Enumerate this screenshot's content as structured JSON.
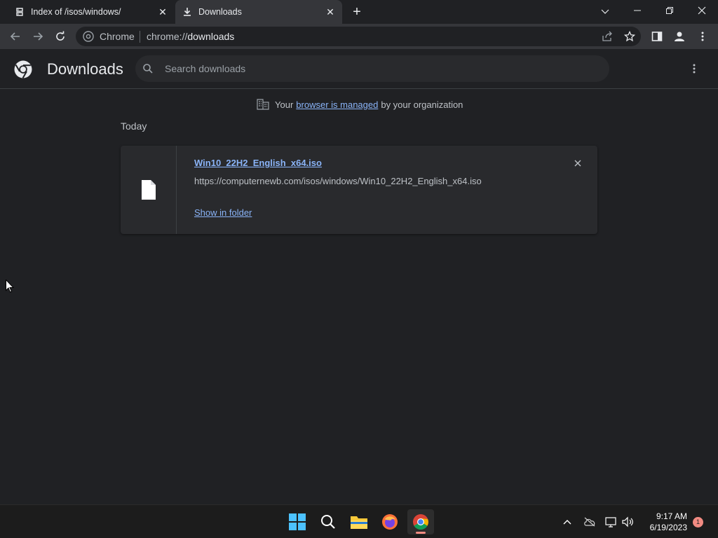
{
  "tabs": [
    {
      "title": "Index of /isos/windows/",
      "favicon": "server-icon",
      "active": false
    },
    {
      "title": "Downloads",
      "favicon": "download-icon",
      "active": true
    }
  ],
  "window_controls": {
    "minimize": "—",
    "restore": "❐",
    "close": "✕",
    "tab_search": "⌄"
  },
  "omnibox": {
    "site_label": "Chrome",
    "url_prefix": "chrome://",
    "url_path": "downloads"
  },
  "downloads_page": {
    "title": "Downloads",
    "search_placeholder": "Search downloads",
    "managed_notice": {
      "prefix": "Your",
      "link": "browser is managed",
      "suffix": "by your organization"
    },
    "date_group": "Today",
    "items": [
      {
        "filename": "Win10_22H2_English_x64.iso",
        "url": "https://computernewb.com/isos/windows/Win10_22H2_English_x64.iso",
        "action": "Show in folder"
      }
    ]
  },
  "taskbar": {
    "apps": [
      "start-icon",
      "search-icon",
      "file-explorer-icon",
      "firefox-icon",
      "chrome-icon"
    ],
    "clock_time": "9:17 AM",
    "clock_date": "6/19/2023",
    "notification_count": "1"
  },
  "colors": {
    "accent": "#8ab4f8",
    "background": "#202124",
    "toolbar": "#35363a",
    "card": "#292a2d"
  }
}
